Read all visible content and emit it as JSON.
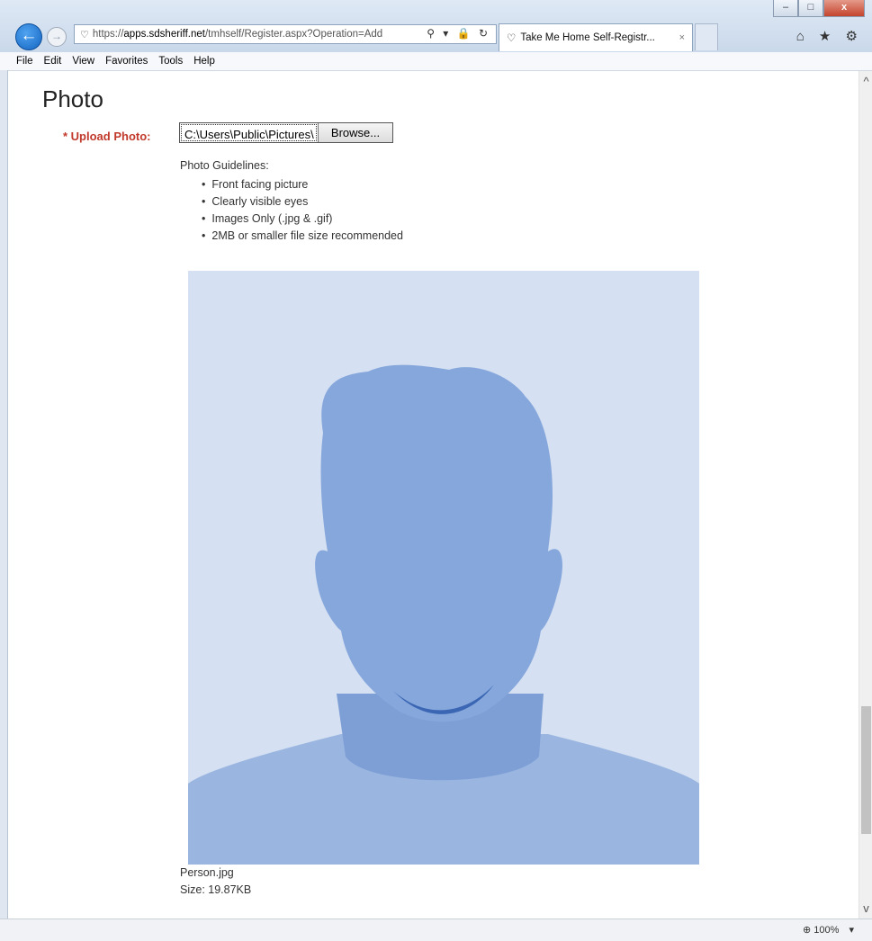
{
  "browser": {
    "address": {
      "scheme": "https://",
      "host": "apps.sdsheriff.net",
      "path": "/tmhself/Register.aspx?Operation=Add"
    },
    "tab_title": "Take Me Home Self-Registr...",
    "tab_close": "×",
    "address_tools": "⚲ ▾ 🔒 ↻",
    "right_icons": "⌂ ★ ⚙",
    "menu": [
      "File",
      "Edit",
      "View",
      "Favorites",
      "Tools",
      "Help"
    ],
    "window_controls": [
      "–",
      "□",
      "x"
    ],
    "zoom": "100%"
  },
  "page": {
    "heading": "Photo",
    "upload_label": "* Upload Photo:",
    "file_path": "C:\\Users\\Public\\Pictures\\",
    "browse_label": "Browse...",
    "guidelines_title": "Photo Guidelines:",
    "guidelines": [
      "Front facing picture",
      "Clearly visible eyes",
      "Images Only (.jpg & .gif)",
      "2MB or smaller file size recommended"
    ],
    "file_name": "Person.jpg",
    "file_size": "Size: 19.87KB"
  },
  "colors": {
    "required_label": "#c0392b",
    "photo_background": "#d5e0f2",
    "silhouette": "#86a7dc",
    "shoulders": "#9ab6e0"
  }
}
